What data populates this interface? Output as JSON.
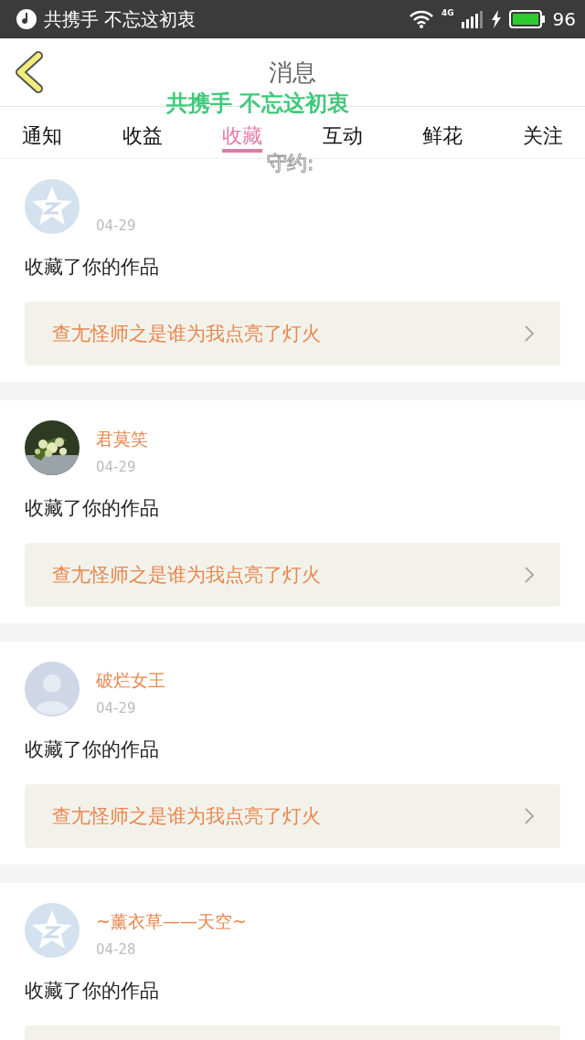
{
  "status_bar": {
    "song": "共携手 不忘这初衷",
    "network": "4G",
    "battery": "96"
  },
  "header": {
    "title": "消息"
  },
  "tabs": [
    {
      "label": "通知",
      "selected": false
    },
    {
      "label": "收益",
      "selected": false
    },
    {
      "label": "收藏",
      "selected": true
    },
    {
      "label": "互动",
      "selected": false
    },
    {
      "label": "鲜花",
      "selected": false
    },
    {
      "label": "关注",
      "selected": false
    }
  ],
  "lyrics_overlay": {
    "line_1": "共携手 不忘这初衷",
    "line_2": "守约:"
  },
  "messages": [
    {
      "avatar": {
        "kind": "qzone"
      },
      "date": "04-29",
      "text": "收藏了你的作品",
      "work_title": "查尢怪师之是谁为我点亮了灯火"
    },
    {
      "name": "君莫笑",
      "date": "04-29",
      "text": "收藏了你的作品",
      "work_title": "查尢怪师之是谁为我点亮了灯火"
    },
    {
      "avatar": {
        "kind": "silhouette"
      },
      "name": "破烂女王",
      "date": "04-29",
      "text": "收藏了你的作品",
      "work_title": "查尢怪师之是谁为我点亮了灯火"
    },
    {
      "avatar": {
        "kind": "qzone"
      },
      "name": "~薰衣草——天空~",
      "date": "04-28",
      "text": "收藏了你的作品"
    }
  ]
}
